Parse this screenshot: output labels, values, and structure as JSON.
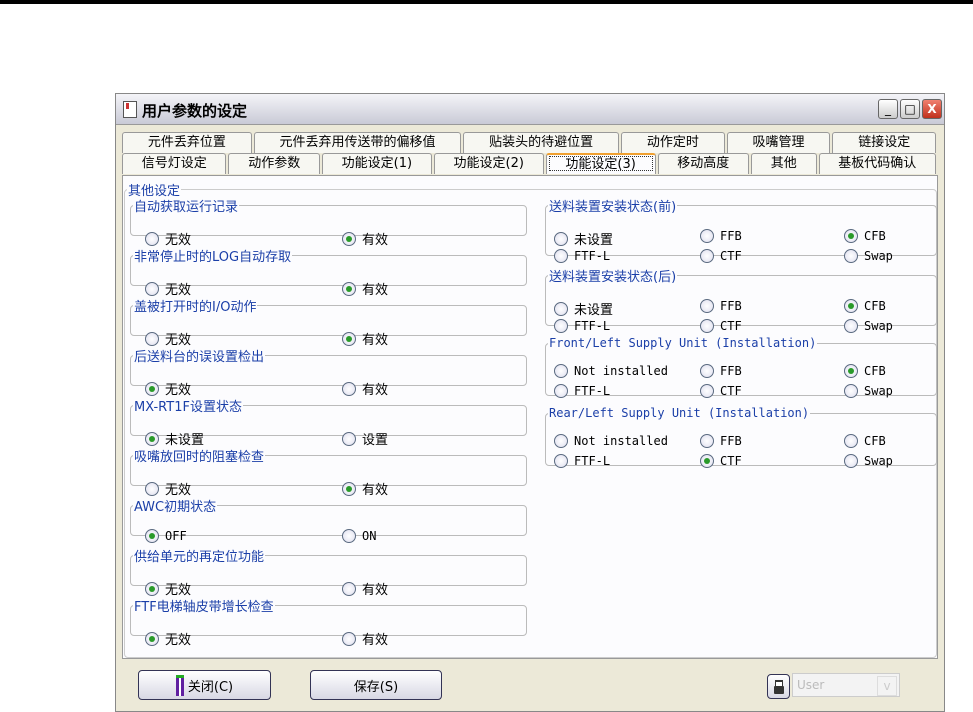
{
  "window": {
    "title": "用户参数的设定",
    "min": "_",
    "max": "□",
    "close": "X"
  },
  "tabs_row1": [
    "元件丢弃位置",
    "元件丢弃用传送带的偏移值",
    "贴装头的待避位置",
    "动作定时",
    "吸嘴管理",
    "链接设定"
  ],
  "tabs_row2": [
    "信号灯设定",
    "动作参数",
    "功能设定(1)",
    "功能设定(2)",
    "功能设定(3)",
    "移动高度",
    "其他",
    "基板代码确认"
  ],
  "active_tab": "功能设定(3)",
  "outer_group": "其他设定",
  "left_groups": [
    {
      "title": "自动获取运行记录",
      "options": [
        "无效",
        "有效"
      ],
      "selected": 1
    },
    {
      "title": "非常停止时的LOG自动存取",
      "options": [
        "无效",
        "有效"
      ],
      "selected": 1
    },
    {
      "title": "盖被打开时的I/O动作",
      "options": [
        "无效",
        "有效"
      ],
      "selected": 1
    },
    {
      "title": "后送料台的误设置检出",
      "options": [
        "无效",
        "有效"
      ],
      "selected": 0
    },
    {
      "title": "MX-RT1F设置状态",
      "options": [
        "未设置",
        "设置"
      ],
      "selected": 0
    },
    {
      "title": "吸嘴放回时的阻塞检查",
      "options": [
        "无效",
        "有效"
      ],
      "selected": 1
    },
    {
      "title": "AWC初期状态",
      "options": [
        "OFF",
        "ON"
      ],
      "selected": 0
    },
    {
      "title": "供给单元的再定位功能",
      "options": [
        "无效",
        "有效"
      ],
      "selected": 0
    },
    {
      "title": "FTF电梯轴皮带增长检查",
      "options": [
        "无效",
        "有效"
      ],
      "selected": 0
    }
  ],
  "right_groups": [
    {
      "title": "送料装置安装状态(前)",
      "options": [
        "未设置",
        "FFB",
        "CFB",
        "FTF-L",
        "CTF",
        "Swap"
      ],
      "selected": 2
    },
    {
      "title": "送料装置安装状态(后)",
      "options": [
        "未设置",
        "FFB",
        "CFB",
        "FTF-L",
        "CTF",
        "Swap"
      ],
      "selected": 2
    },
    {
      "title": "Front/Left Supply Unit (Installation)",
      "options": [
        "Not installed",
        "FFB",
        "CFB",
        "FTF-L",
        "CTF",
        "Swap"
      ],
      "selected": 2
    },
    {
      "title": "Rear/Left Supply Unit (Installation)",
      "options": [
        "Not installed",
        "FFB",
        "CFB",
        "FTF-L",
        "CTF",
        "Swap"
      ],
      "selected": 4
    }
  ],
  "footer": {
    "close_label": "关闭(C)",
    "save_label": "保存(S)",
    "user_combo": "User",
    "combo_arrow": "v"
  }
}
